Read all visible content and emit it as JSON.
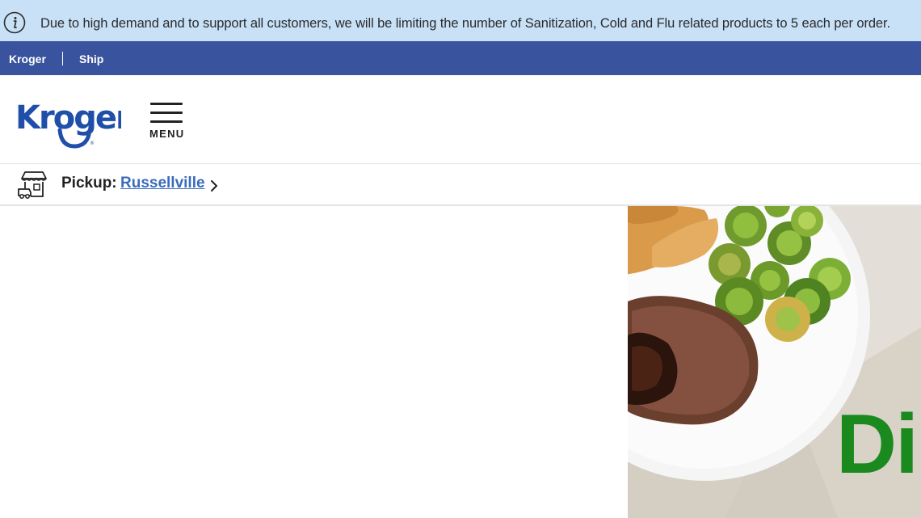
{
  "alert": {
    "icon": "info-icon",
    "message": "Due to high demand and to support all customers, we will be limiting the number of Sanitization, Cold and Flu related products to 5 each per order."
  },
  "topnav": {
    "links": [
      "Kroger",
      "Ship"
    ]
  },
  "header": {
    "logo_text": "Kroger",
    "menu_label": "MENU"
  },
  "pickup": {
    "label": "Pickup:",
    "store": "Russellville"
  },
  "hero": {
    "headline_fragment": "Di"
  },
  "colors": {
    "alert_bg": "#c8e1f7",
    "nav_bg": "#3a539e",
    "brand_blue": "#1f4fa8",
    "link_blue": "#3a6bbd",
    "hero_green": "#1a8a1f"
  }
}
